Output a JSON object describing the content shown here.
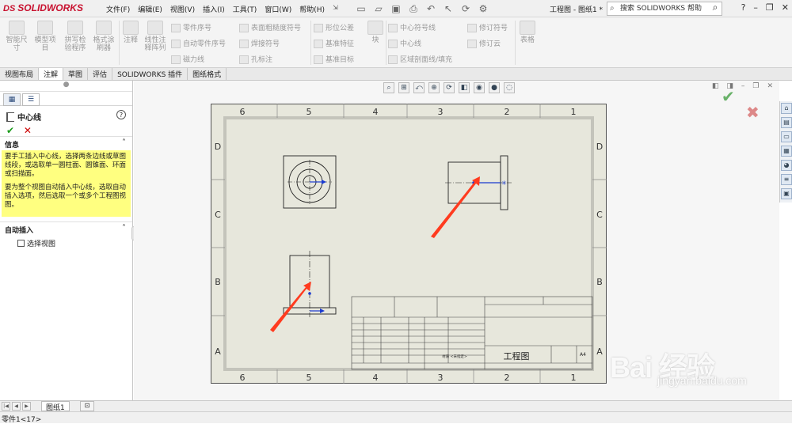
{
  "app": {
    "brand": "SOLIDWORKS",
    "doc_title": "工程图 - 图纸1 *",
    "search_placeholder": "搜索 SOLIDWORKS 帮助",
    "menus": [
      "文件(F)",
      "编辑(E)",
      "视图(V)",
      "插入(I)",
      "工具(T)",
      "窗口(W)",
      "帮助(H)"
    ]
  },
  "ribbon": {
    "smart_dim": "智能尺寸",
    "model_items": "模型项目",
    "spell_check": "拼写检验程序",
    "format_painter": "格式涂刷器",
    "note": "注释",
    "linear_note_pattern": "线性注释阵列",
    "balloon": "零件序号",
    "auto_balloon": "自动零件序号",
    "magnetic_line": "磁力线",
    "surface_finish": "表面粗糙度符号",
    "weld_symbol": "焊接符号",
    "hole_callout": "孔标注",
    "gtol": "形位公差",
    "datum_feature": "基准特征",
    "datum_target": "基准目标",
    "block": "块",
    "center_mark": "中心符号线",
    "centerline": "中心线",
    "area_hatch": "区域剖面线/填充",
    "revision_symbol": "修订符号",
    "revision_cloud": "修订云",
    "table": "表格"
  },
  "tabs": [
    "视图布局",
    "注解",
    "草图",
    "评估",
    "SOLIDWORKS 插件",
    "图纸格式"
  ],
  "active_tab": "注解",
  "panel": {
    "title": "中心线",
    "help": "?",
    "info_header": "信息",
    "info_p1": "要手工插入中心线，选择两条边线或草图线段，或选取单一圆柱面、圆锥面、环面或扫描面。",
    "info_p2": "要为整个视图自动插入中心线，选取自动插入选项，然后选取一个或多个工程图视图。",
    "auto_header": "自动插入",
    "select_views": "选择视图"
  },
  "drawing": {
    "cols_top": [
      "6",
      "5",
      "4",
      "3",
      "2",
      "1"
    ],
    "rows": [
      "D",
      "C",
      "B",
      "A"
    ],
    "title_text": "工程图",
    "size_label": "A4",
    "material_text": "材质 <未指定>"
  },
  "sheet_tab": "图纸1",
  "status_text": "零件1<17>",
  "watermark": {
    "main": "Bai 经验",
    "sub": "jingyan.baidu.com"
  },
  "colors": {
    "brand_red": "#c8102e",
    "info_yellow": "#ffff80",
    "sheet_bg": "#e7e7dc",
    "arrow_red": "#ff3b1f",
    "ok_green": "#1a9a1a"
  }
}
